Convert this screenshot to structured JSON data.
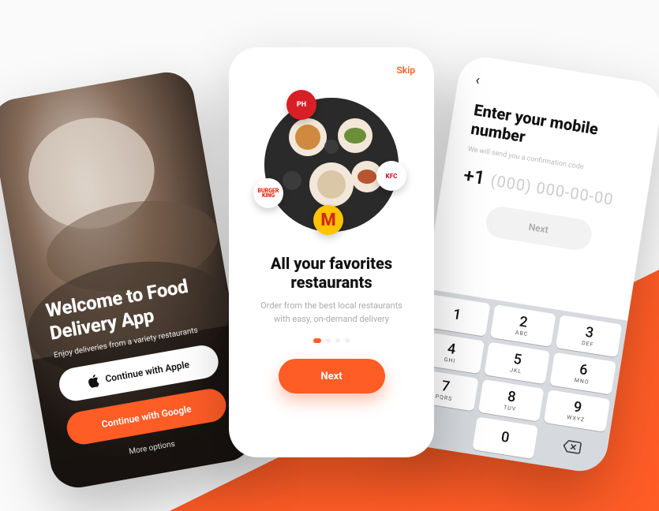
{
  "colors": {
    "accent": "#ff5c26"
  },
  "screen1": {
    "title": "Welcome to Food Delivery App",
    "subtitle": "Enjoy deliveries from a variety restaurants",
    "apple_button": "Continue with Apple",
    "google_button": "Continue with Google",
    "more_options": "More options"
  },
  "screen2": {
    "skip": "Skip",
    "title": "All your favorites restaurants",
    "description": "Order from the best local restaurants with easy, on-demand delivery",
    "next": "Next",
    "badges": {
      "pizza_hut": "PH",
      "burger_king_line1": "BURGER",
      "burger_king_line2": "KING",
      "mcdonalds": "M",
      "kfc": "KFC"
    },
    "dot_count": 4,
    "active_dot": 0
  },
  "screen3": {
    "title": "Enter your mobile number",
    "subtitle": "We will send you a confirmation code",
    "country_code": "+1",
    "placeholder": "(000) 000-00-00",
    "next": "Next",
    "keypad": [
      {
        "digit": "1",
        "letters": ""
      },
      {
        "digit": "2",
        "letters": "ABC"
      },
      {
        "digit": "3",
        "letters": "DEF"
      },
      {
        "digit": "4",
        "letters": "GHI"
      },
      {
        "digit": "5",
        "letters": "JKL"
      },
      {
        "digit": "6",
        "letters": "MNO"
      },
      {
        "digit": "7",
        "letters": "PQRS"
      },
      {
        "digit": "8",
        "letters": "TUV"
      },
      {
        "digit": "9",
        "letters": "WXYZ"
      },
      {
        "digit": "",
        "letters": ""
      },
      {
        "digit": "0",
        "letters": ""
      },
      {
        "digit": "⌫",
        "letters": ""
      }
    ]
  }
}
